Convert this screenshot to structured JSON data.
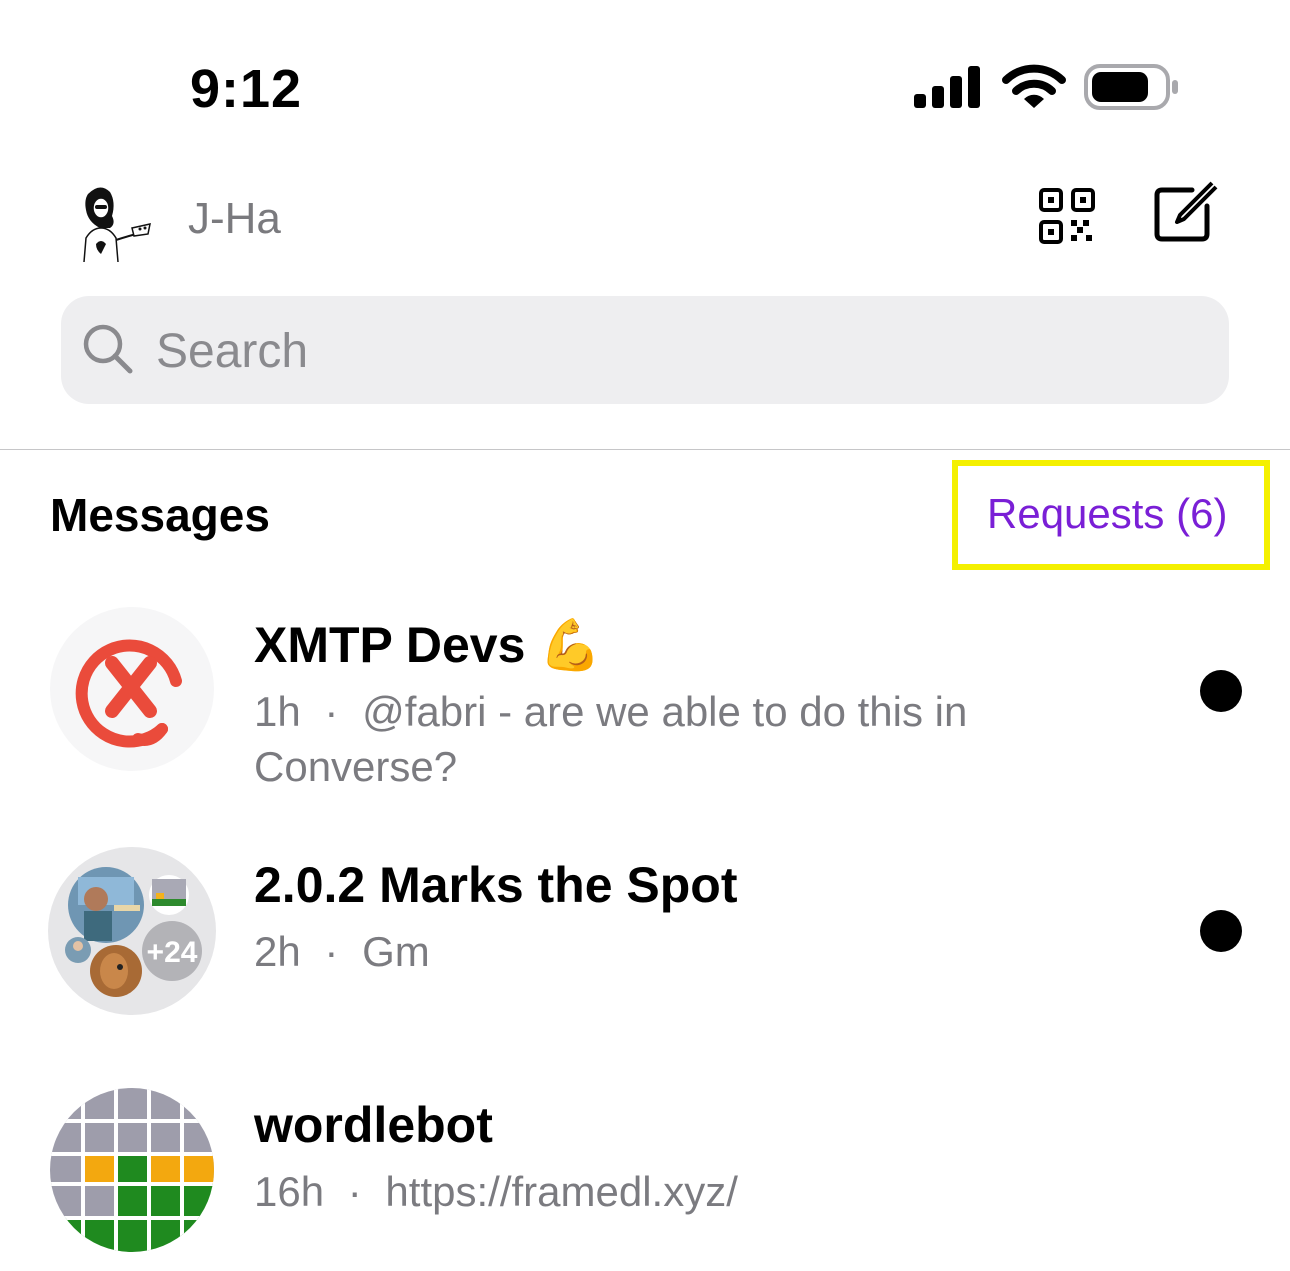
{
  "status_bar": {
    "time": "9:12"
  },
  "header": {
    "username": "J-Ha"
  },
  "search": {
    "placeholder": "Search"
  },
  "messages": {
    "title": "Messages",
    "requests_label": "Requests (6)",
    "highlight_color": "#f4f000",
    "accent_color": "#7a1fd6"
  },
  "conversations": [
    {
      "title": "XMTP Devs",
      "emoji": "💪",
      "time": "1h",
      "separator": "·",
      "preview_line1": "@fabri - are we able to do this in",
      "preview_line2": "Converse?",
      "unread": true,
      "avatar_icon": "xmtp-logo-icon"
    },
    {
      "title": "2.0.2 Marks the Spot",
      "time": "2h",
      "separator": "·",
      "preview": "Gm",
      "unread": true,
      "extra_members": "+24",
      "avatar_icon": "group-avatar"
    },
    {
      "title": "wordlebot",
      "time": "16h",
      "separator": "·",
      "preview": "https://framedl.xyz/",
      "unread": false,
      "avatar_icon": "wordle-grid-icon"
    }
  ]
}
